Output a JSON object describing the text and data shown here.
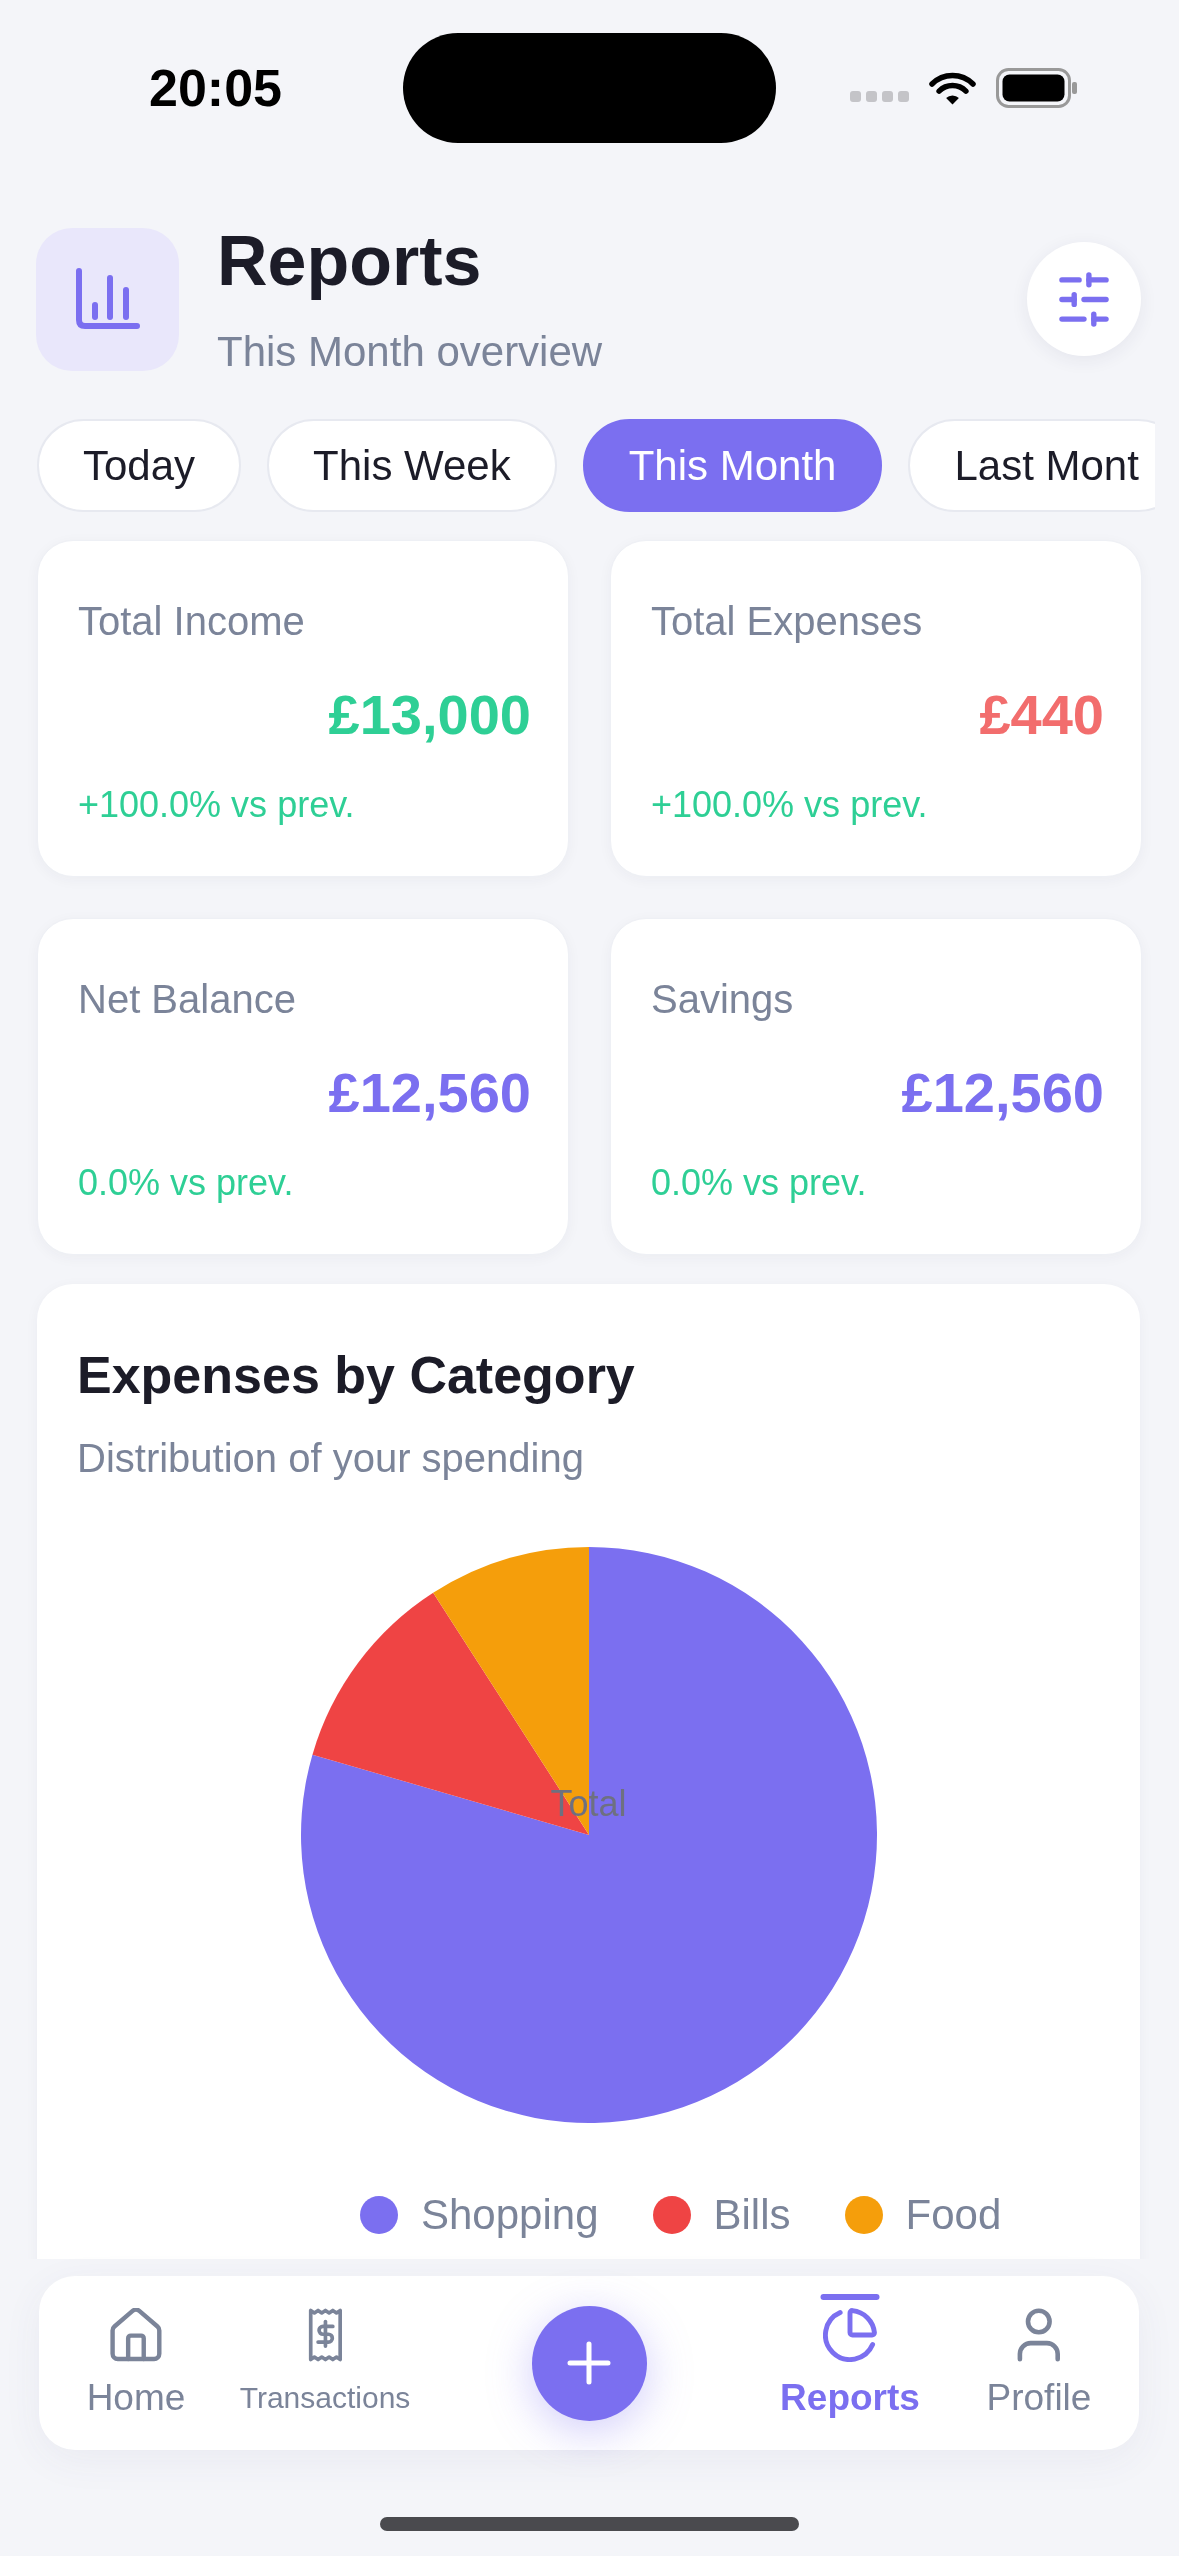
{
  "status_bar": {
    "time": "20:05"
  },
  "header": {
    "title": "Reports",
    "subtitle": "This Month overview"
  },
  "period_tabs": [
    {
      "label": "Today",
      "selected": false
    },
    {
      "label": "This Week",
      "selected": false
    },
    {
      "label": "This Month",
      "selected": true
    },
    {
      "label": "Last Mont",
      "selected": false
    }
  ],
  "stats": [
    {
      "label": "Total Income",
      "value": "£13,000",
      "color": "#2ecf95",
      "change": "+100.0% vs prev."
    },
    {
      "label": "Total Expenses",
      "value": "£440",
      "color": "#f26d6d",
      "change": "+100.0% vs prev."
    },
    {
      "label": "Net Balance",
      "value": "£12,560",
      "color": "#7b6ff0",
      "change": "0.0% vs prev."
    },
    {
      "label": "Savings",
      "value": "£12,560",
      "color": "#7b6ff0",
      "change": "0.0% vs prev."
    }
  ],
  "chart": {
    "title": "Expenses by Category",
    "subtitle": "Distribution of your spending",
    "center_label": "Total",
    "legend": [
      {
        "label": "Shopping",
        "color": "#7b6ff0"
      },
      {
        "label": "Bills",
        "color": "#ef4444"
      },
      {
        "label": "Food",
        "color": "#f59e0b"
      }
    ]
  },
  "bottom_nav": [
    {
      "label": "Home",
      "selected": false
    },
    {
      "label": "Transactions",
      "selected": false
    },
    {
      "label": "Reports",
      "selected": true
    },
    {
      "label": "Profile",
      "selected": false
    }
  ]
}
